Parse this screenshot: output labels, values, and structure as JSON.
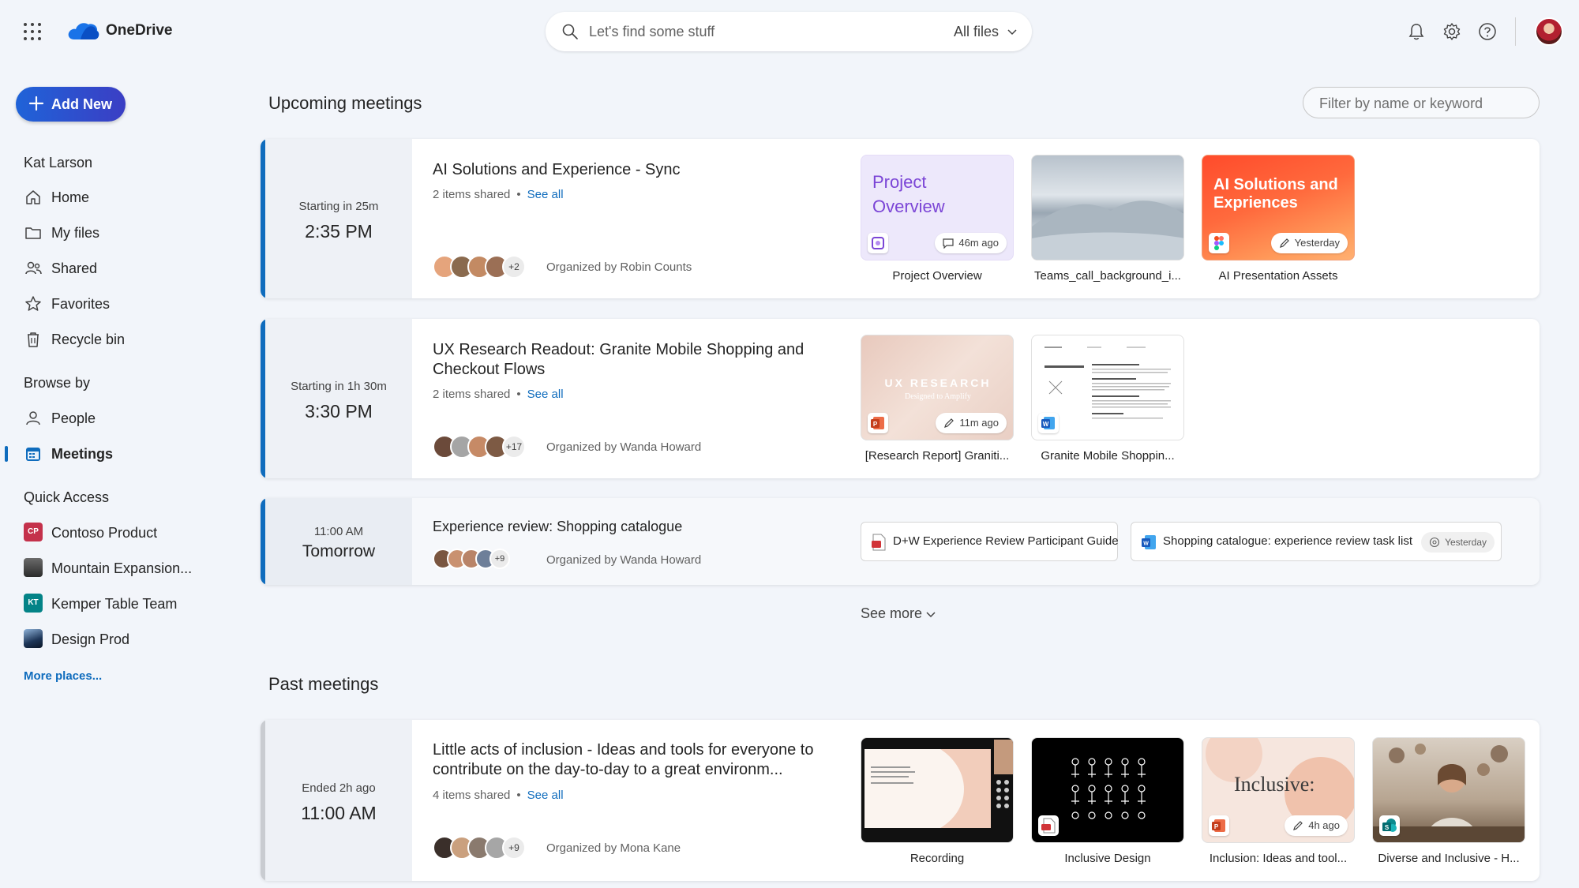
{
  "app": {
    "title": "OneDrive"
  },
  "search": {
    "placeholder": "Let's find some stuff",
    "scope": "All files"
  },
  "sidebar": {
    "add_new": "Add New",
    "user": "Kat Larson",
    "nav": [
      "Home",
      "My files",
      "Shared",
      "Favorites",
      "Recycle bin"
    ],
    "browse_by": "Browse by",
    "browse": [
      "People",
      "Meetings"
    ],
    "active": "Meetings",
    "quick_access": "Quick Access",
    "quick": [
      {
        "label": "Contoso Product",
        "badge": "CP",
        "color": "#c4314b"
      },
      {
        "label": "Mountain Expansion...",
        "badge": "",
        "color": "#3b3b3b"
      },
      {
        "label": "Kemper Table Team",
        "badge": "KT",
        "color": "#038387"
      },
      {
        "label": "Design Prod",
        "badge": "",
        "color": "#2b4a6f"
      }
    ],
    "more_places": "More places..."
  },
  "main": {
    "upcoming_title": "Upcoming meetings",
    "filter_placeholder": "Filter by name or keyword",
    "see_more": "See more",
    "past_title": "Past meetings",
    "upcoming": [
      {
        "when": "Starting in 25m",
        "time": "2:35 PM",
        "title": "AI Solutions and Experience - Sync",
        "shared": "2 items shared",
        "see_all": "See all",
        "more_attendees": "+2",
        "organizer": "Organized by Robin Counts",
        "files": [
          {
            "caption": "Project Overview",
            "thumb_title": "Project Overview",
            "activity": "46m ago"
          },
          {
            "caption": "Teams_call_background_i...",
            "thumb_title": "",
            "activity": ""
          },
          {
            "caption": "AI Presentation Assets",
            "thumb_title": "AI Solutions and Expriences",
            "activity": "Yesterday"
          }
        ]
      },
      {
        "when": "Starting in 1h 30m",
        "time": "3:30 PM",
        "title": "UX Research Readout: Granite Mobile Shopping and Checkout Flows",
        "shared": "2 items shared",
        "see_all": "See all",
        "more_attendees": "+17",
        "organizer": "Organized by Wanda Howard",
        "files": [
          {
            "caption": "[Research Report] Graniti...",
            "thumb_title": "UX RESEARCH",
            "thumb_sub": "Designed to Amplify",
            "activity": "11m ago"
          },
          {
            "caption": "Granite Mobile Shoppin...",
            "thumb_title": "",
            "activity": ""
          }
        ]
      },
      {
        "when": "11:00 AM",
        "time": "Tomorrow",
        "title": "Experience review: Shopping catalogue",
        "more_attendees": "+9",
        "organizer": "Organized by Wanda Howard",
        "files": [
          {
            "caption": "D+W Experience Review Participant Guide",
            "activity": ""
          },
          {
            "caption": "Shopping catalogue: experience review task list",
            "activity": "Yesterday"
          }
        ]
      }
    ],
    "past": [
      {
        "when": "Ended 2h ago",
        "time": "11:00 AM",
        "title": "Little acts of inclusion - Ideas and tools for everyone to contribute on the day-to-day to a great environm...",
        "shared": "4 items shared",
        "see_all": "See all",
        "more_attendees": "+9",
        "organizer": "Organized by Mona Kane",
        "files": [
          {
            "caption": "Recording",
            "activity": ""
          },
          {
            "caption": "Inclusive Design",
            "activity": ""
          },
          {
            "caption": "Inclusion: Ideas and tool...",
            "thumb_title": "Inclusive:",
            "activity": "4h ago"
          },
          {
            "caption": "Diverse and Inclusive - H...",
            "activity": ""
          }
        ]
      }
    ]
  }
}
